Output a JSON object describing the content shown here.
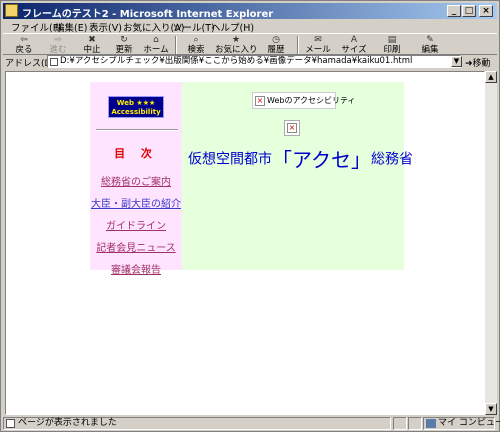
{
  "window": {
    "title": "フレームのテスト2 - Microsoft Internet Explorer",
    "minimize": "_",
    "maximize": "□",
    "close": "×"
  },
  "menu": [
    "ファイル(F)",
    "編集(E)",
    "表示(V)",
    "お気に入り(A)",
    "ツール(T)",
    "ヘルプ(H)"
  ],
  "toolbar": {
    "back": "戻る",
    "forward": "進む",
    "stop": "中止",
    "refresh": "更新",
    "home": "ホーム",
    "search": "検索",
    "favorites": "お気に入り",
    "history": "履歴",
    "mail": "メール",
    "size": "サイズ",
    "print": "印刷",
    "edit": "編集"
  },
  "address": {
    "label": "アドレス(D)",
    "url": "D:¥アクセシブルチェック¥出版関係¥ここから始める¥画像データ¥hamada¥kaiku01.html",
    "go": "移動"
  },
  "left_frame": {
    "logo_line1": "Web ★★★",
    "logo_line2": "Accessibility",
    "toc_title": "目 次",
    "links": [
      "総務省のご案内",
      "大臣・副大臣の紹介",
      "ガイドライン",
      "記者会見ニュース",
      "審議会報告"
    ]
  },
  "right_frame": {
    "header_alt": "Webのアクセシビリティ",
    "headline_pre": "仮想空間都市",
    "headline_big": "「アクセ」",
    "headline_post": "総務省"
  },
  "status": {
    "text": "ページが表示されました",
    "zone": "マイ コンピュータ"
  },
  "colors": {
    "left_frame_bg": "#ffe4ff",
    "right_frame_bg": "#e6ffdc",
    "headline": "#0000cc",
    "toc_title": "#e00000"
  }
}
